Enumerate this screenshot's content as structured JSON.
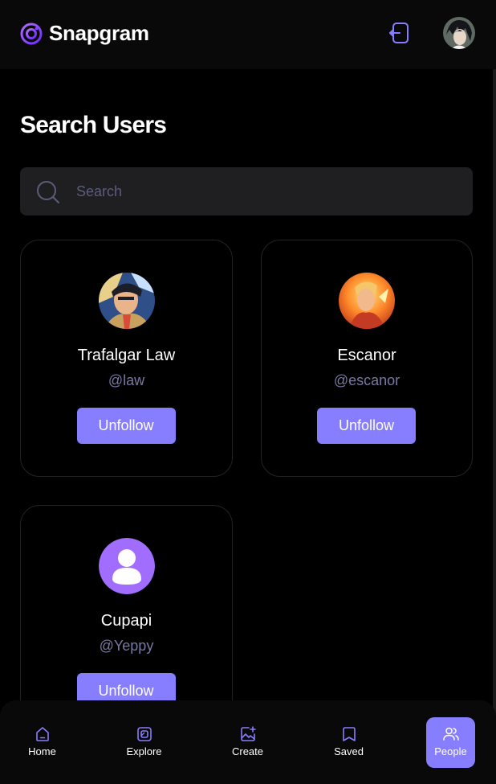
{
  "app": {
    "name": "Snapgram"
  },
  "page": {
    "title": "Search Users"
  },
  "search": {
    "placeholder": "Search",
    "value": ""
  },
  "users": [
    {
      "name": "Trafalgar Law",
      "handle": "@law",
      "action": "Unfollow",
      "avatar": "anime-portrait"
    },
    {
      "name": "Escanor",
      "handle": "@escanor",
      "action": "Unfollow",
      "avatar": "anime-portrait"
    },
    {
      "name": "Cupapi",
      "handle": "@Yeppy",
      "action": "Unfollow",
      "avatar": "default-user-icon"
    }
  ],
  "nav": [
    {
      "label": "Home",
      "icon": "home-icon",
      "active": false
    },
    {
      "label": "Explore",
      "icon": "explore-icon",
      "active": false
    },
    {
      "label": "Create",
      "icon": "create-icon",
      "active": false
    },
    {
      "label": "Saved",
      "icon": "saved-icon",
      "active": false
    },
    {
      "label": "People",
      "icon": "people-icon",
      "active": true
    }
  ],
  "colors": {
    "accent": "#877eff",
    "background": "#000000",
    "surface": "#1f1f22",
    "muted": "#7878a3"
  }
}
